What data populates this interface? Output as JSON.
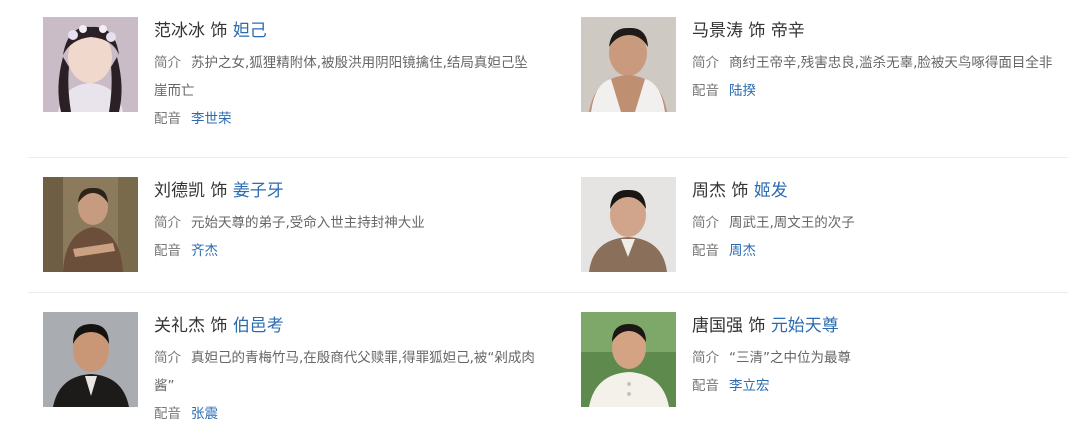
{
  "cast": [
    {
      "actor": "范冰冰",
      "verb": "饰",
      "role": "妲己",
      "intro_label": "简介",
      "intro": "苏护之女,狐狸精附体,被殷洪用阴阳镜擒住,结局真妲己坠崖而亡",
      "dub_label": "配音",
      "voice_actor": "李世荣"
    },
    {
      "actor": "马景涛",
      "verb": "饰",
      "role": "帝辛",
      "intro_label": "简介",
      "intro": "商纣王帝辛,残害忠良,滥杀无辜,脸被天鸟啄得面目全非",
      "dub_label": "配音",
      "voice_actor": "陆揆"
    },
    {
      "actor": "刘德凯",
      "verb": "饰",
      "role": "姜子牙",
      "intro_label": "简介",
      "intro": "元始天尊的弟子,受命入世主持封神大业",
      "dub_label": "配音",
      "voice_actor": "齐杰"
    },
    {
      "actor": "周杰",
      "verb": "饰",
      "role": "姬发",
      "intro_label": "简介",
      "intro": "周武王,周文王的次子",
      "dub_label": "配音",
      "voice_actor": "周杰"
    },
    {
      "actor": "关礼杰",
      "verb": "饰",
      "role": "伯邑考",
      "intro_label": "简介",
      "intro": "真妲己的青梅竹马,在殷商代父赎罪,得罪狐妲己,被“剁成肉酱”",
      "dub_label": "配音",
      "voice_actor": "张震"
    },
    {
      "actor": "唐国强",
      "verb": "饰",
      "role": "元始天尊",
      "intro_label": "简介",
      "intro": "“三清”之中位为最尊",
      "dub_label": "配音",
      "voice_actor": "李立宏"
    }
  ]
}
